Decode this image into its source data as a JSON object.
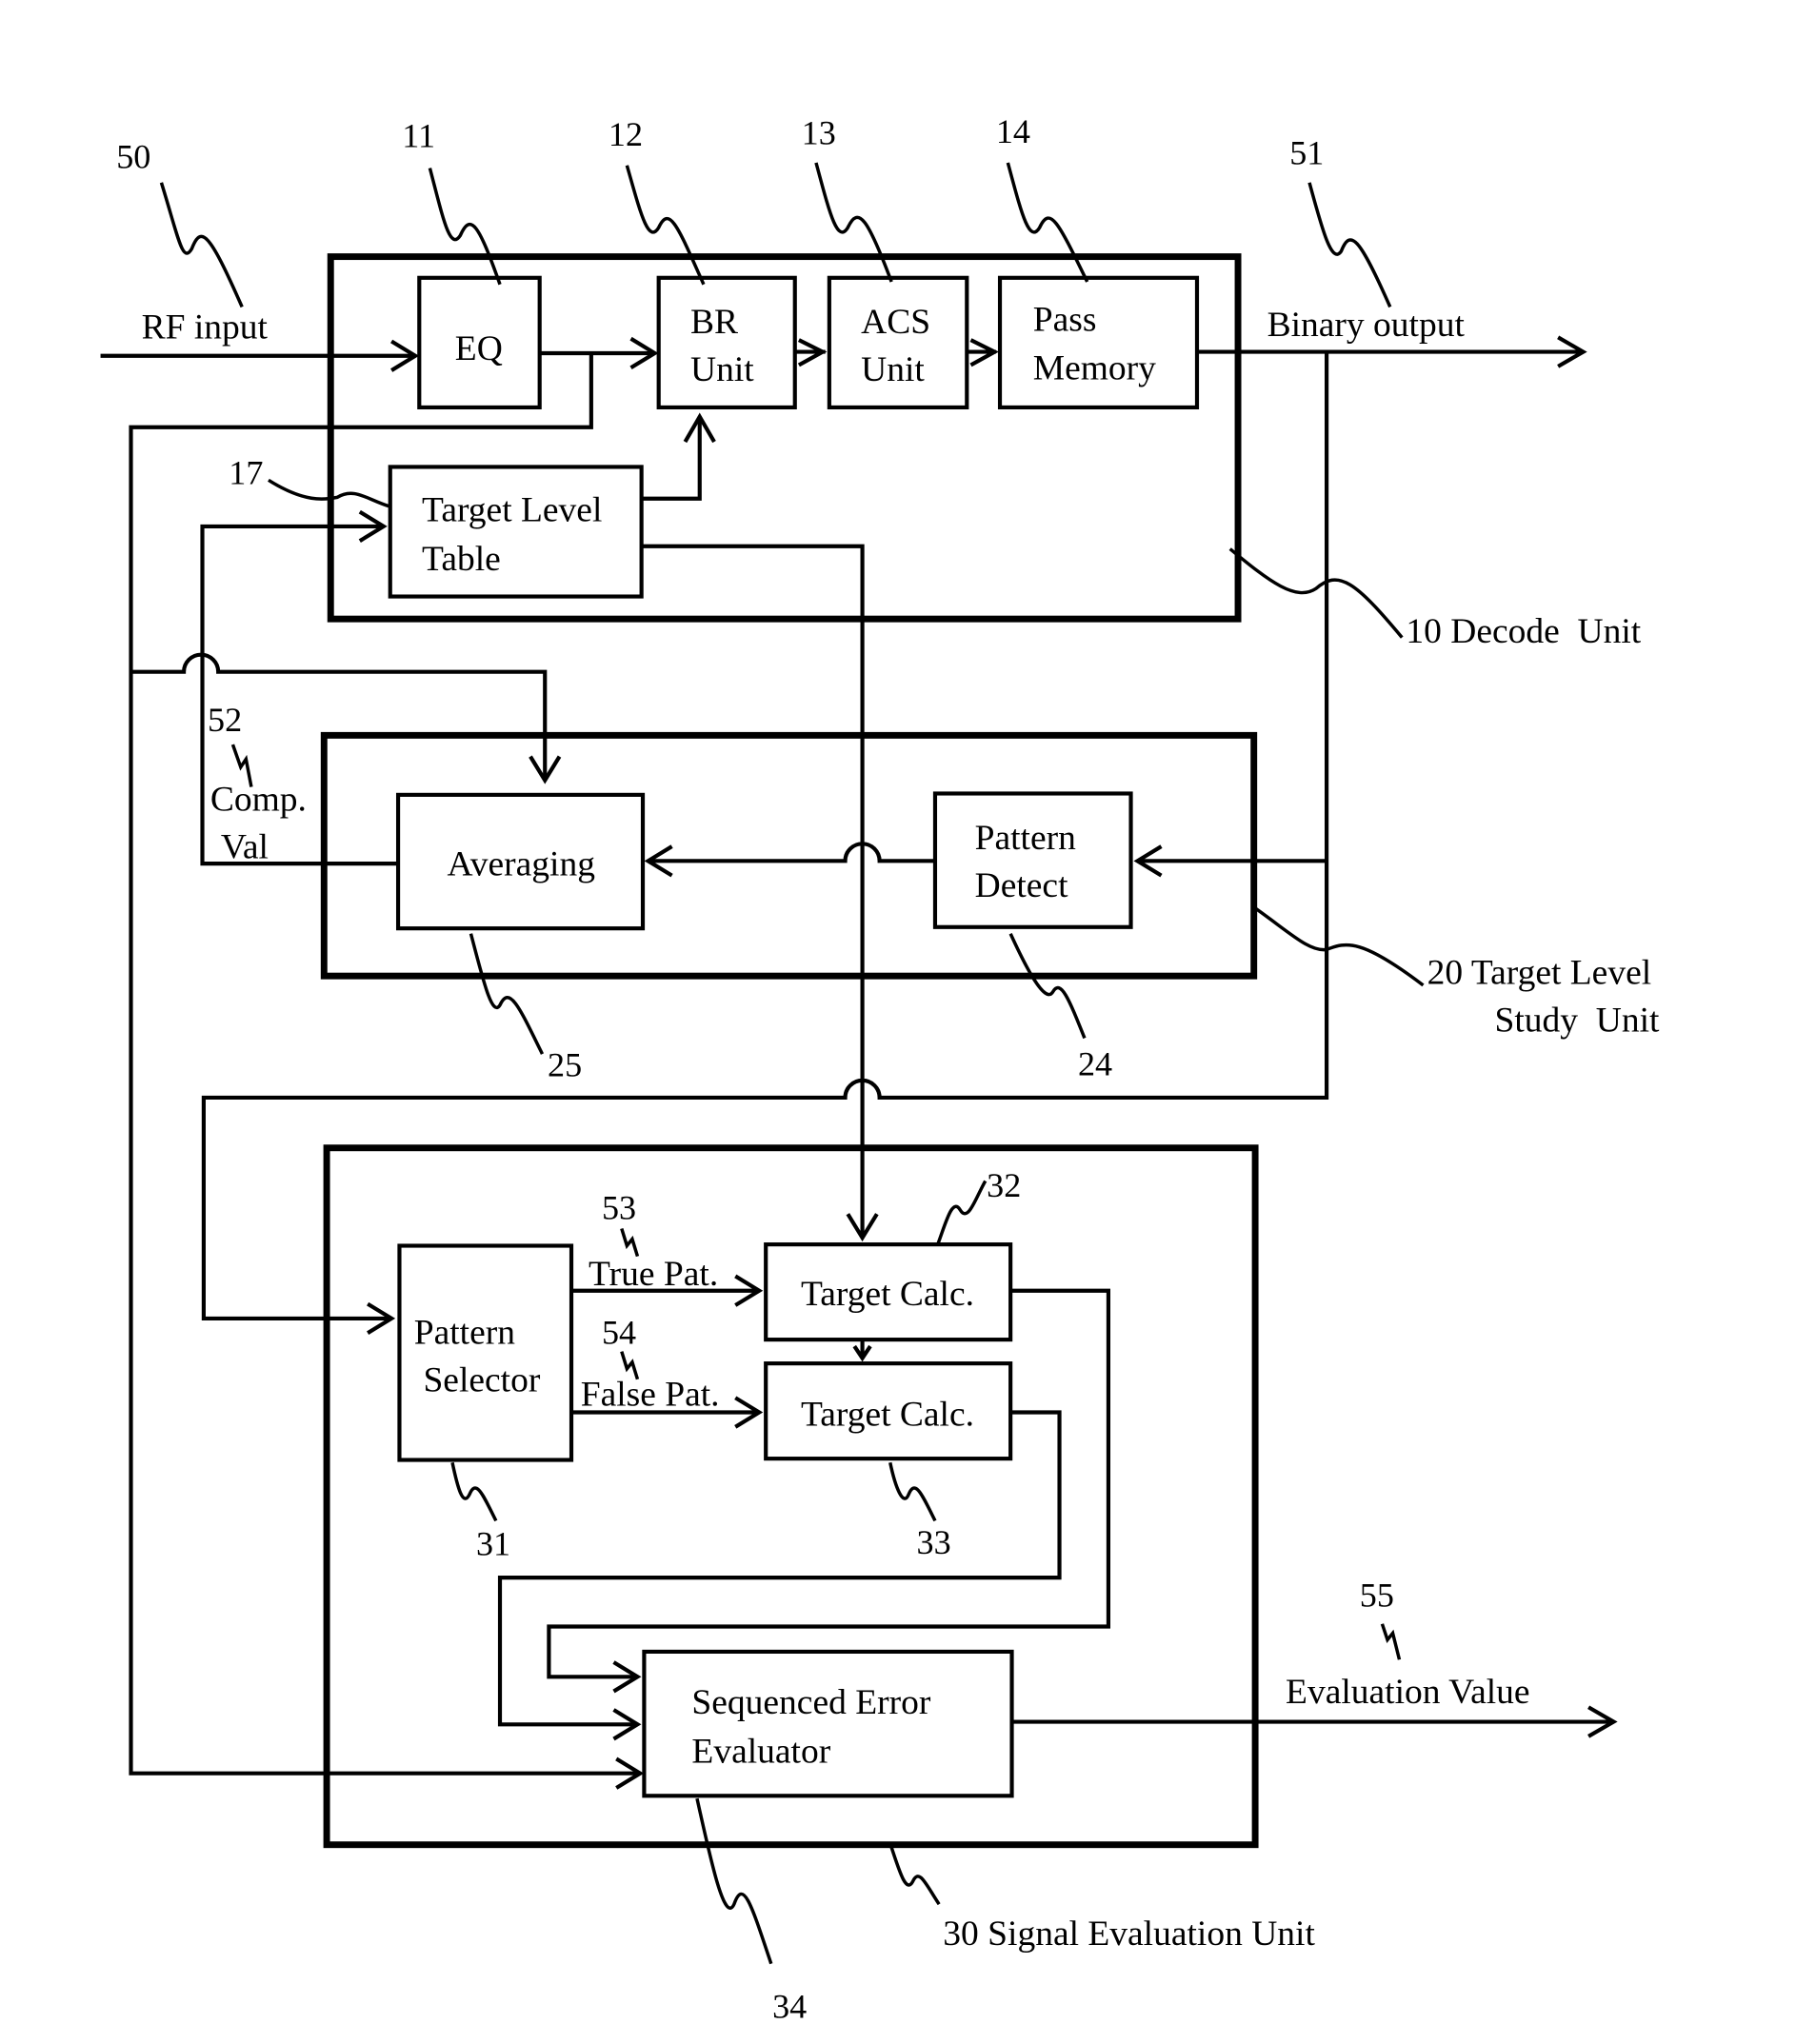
{
  "figure": {
    "type": "block diagram",
    "units": [
      {
        "ref": "10",
        "label": "10 Decode  Unit"
      },
      {
        "ref": "20",
        "label_line1": "20 Target Level",
        "label_line2": "Study  Unit"
      },
      {
        "ref": "30",
        "label": "30 Signal Evaluation Unit"
      }
    ],
    "blocks": {
      "eq": {
        "ref": "11",
        "lines": [
          "EQ"
        ]
      },
      "br": {
        "ref": "12",
        "lines": [
          "BR",
          "Unit"
        ]
      },
      "acs": {
        "ref": "13",
        "lines": [
          "ACS",
          "Unit"
        ]
      },
      "pass": {
        "ref": "14",
        "lines": [
          "Pass",
          "Memory"
        ]
      },
      "tlt": {
        "ref": "17",
        "lines": [
          "Target Level",
          "Table"
        ]
      },
      "avg": {
        "ref": "25",
        "lines": [
          "Averaging"
        ]
      },
      "pdet": {
        "ref": "24",
        "lines": [
          "Pattern",
          "Detect"
        ]
      },
      "psel": {
        "ref": "31",
        "lines": [
          "Pattern",
          "Selector"
        ]
      },
      "tc1": {
        "ref": "32",
        "lines": [
          "Target Calc."
        ]
      },
      "tc2": {
        "ref": "33",
        "lines": [
          "Target Calc."
        ]
      },
      "see": {
        "ref": "34",
        "lines": [
          "Sequenced Error",
          "Evaluator"
        ]
      }
    },
    "signals": {
      "rf": {
        "ref": "50",
        "label": "RF input"
      },
      "bin": {
        "ref": "51",
        "label": "Binary output"
      },
      "comp": {
        "ref": "52",
        "label_line1": "Comp.",
        "label_line2": "Val"
      },
      "truep": {
        "ref": "53",
        "label": "True Pat."
      },
      "falsep": {
        "ref": "54",
        "label": "False Pat."
      },
      "eval": {
        "ref": "55",
        "label": "Evaluation Value"
      }
    }
  }
}
